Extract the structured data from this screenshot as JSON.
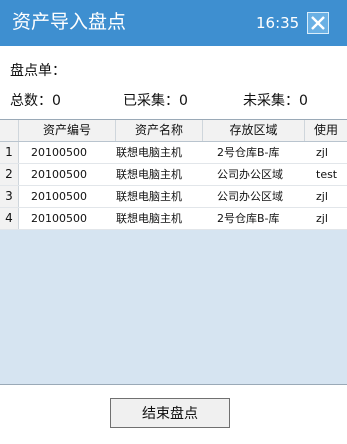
{
  "window": {
    "title": "资产导入盘点",
    "time": "16:35",
    "close_icon": "close-icon"
  },
  "order": {
    "label": "盘点单：",
    "value": ""
  },
  "stats": {
    "total_label": "总数：",
    "total_value": "0",
    "collected_label": "已采集：",
    "collected_value": "0",
    "uncollected_label": "未采集：",
    "uncollected_value": "0"
  },
  "table": {
    "columns": [
      "",
      "资产编号",
      "资产名称",
      "存放区域",
      "使用"
    ],
    "rows": [
      {
        "index": "1",
        "asset_no": "20100500",
        "asset_name": "联想电脑主机",
        "location": "2号仓库B-库",
        "user": "zjl"
      },
      {
        "index": "2",
        "asset_no": "20100500",
        "asset_name": "联想电脑主机",
        "location": "公司办公区域",
        "user": "test"
      },
      {
        "index": "3",
        "asset_no": "20100500",
        "asset_name": "联想电脑主机",
        "location": "公司办公区域",
        "user": "zjl"
      },
      {
        "index": "4",
        "asset_no": "20100500",
        "asset_name": "联想电脑主机",
        "location": "2号仓库B-库",
        "user": "zjl"
      }
    ]
  },
  "footer": {
    "finish_label": "结束盘点"
  },
  "colors": {
    "titlebar": "#3e8fd0",
    "grid_background": "#d6e4f1",
    "header_background": "#f2f2f2"
  }
}
